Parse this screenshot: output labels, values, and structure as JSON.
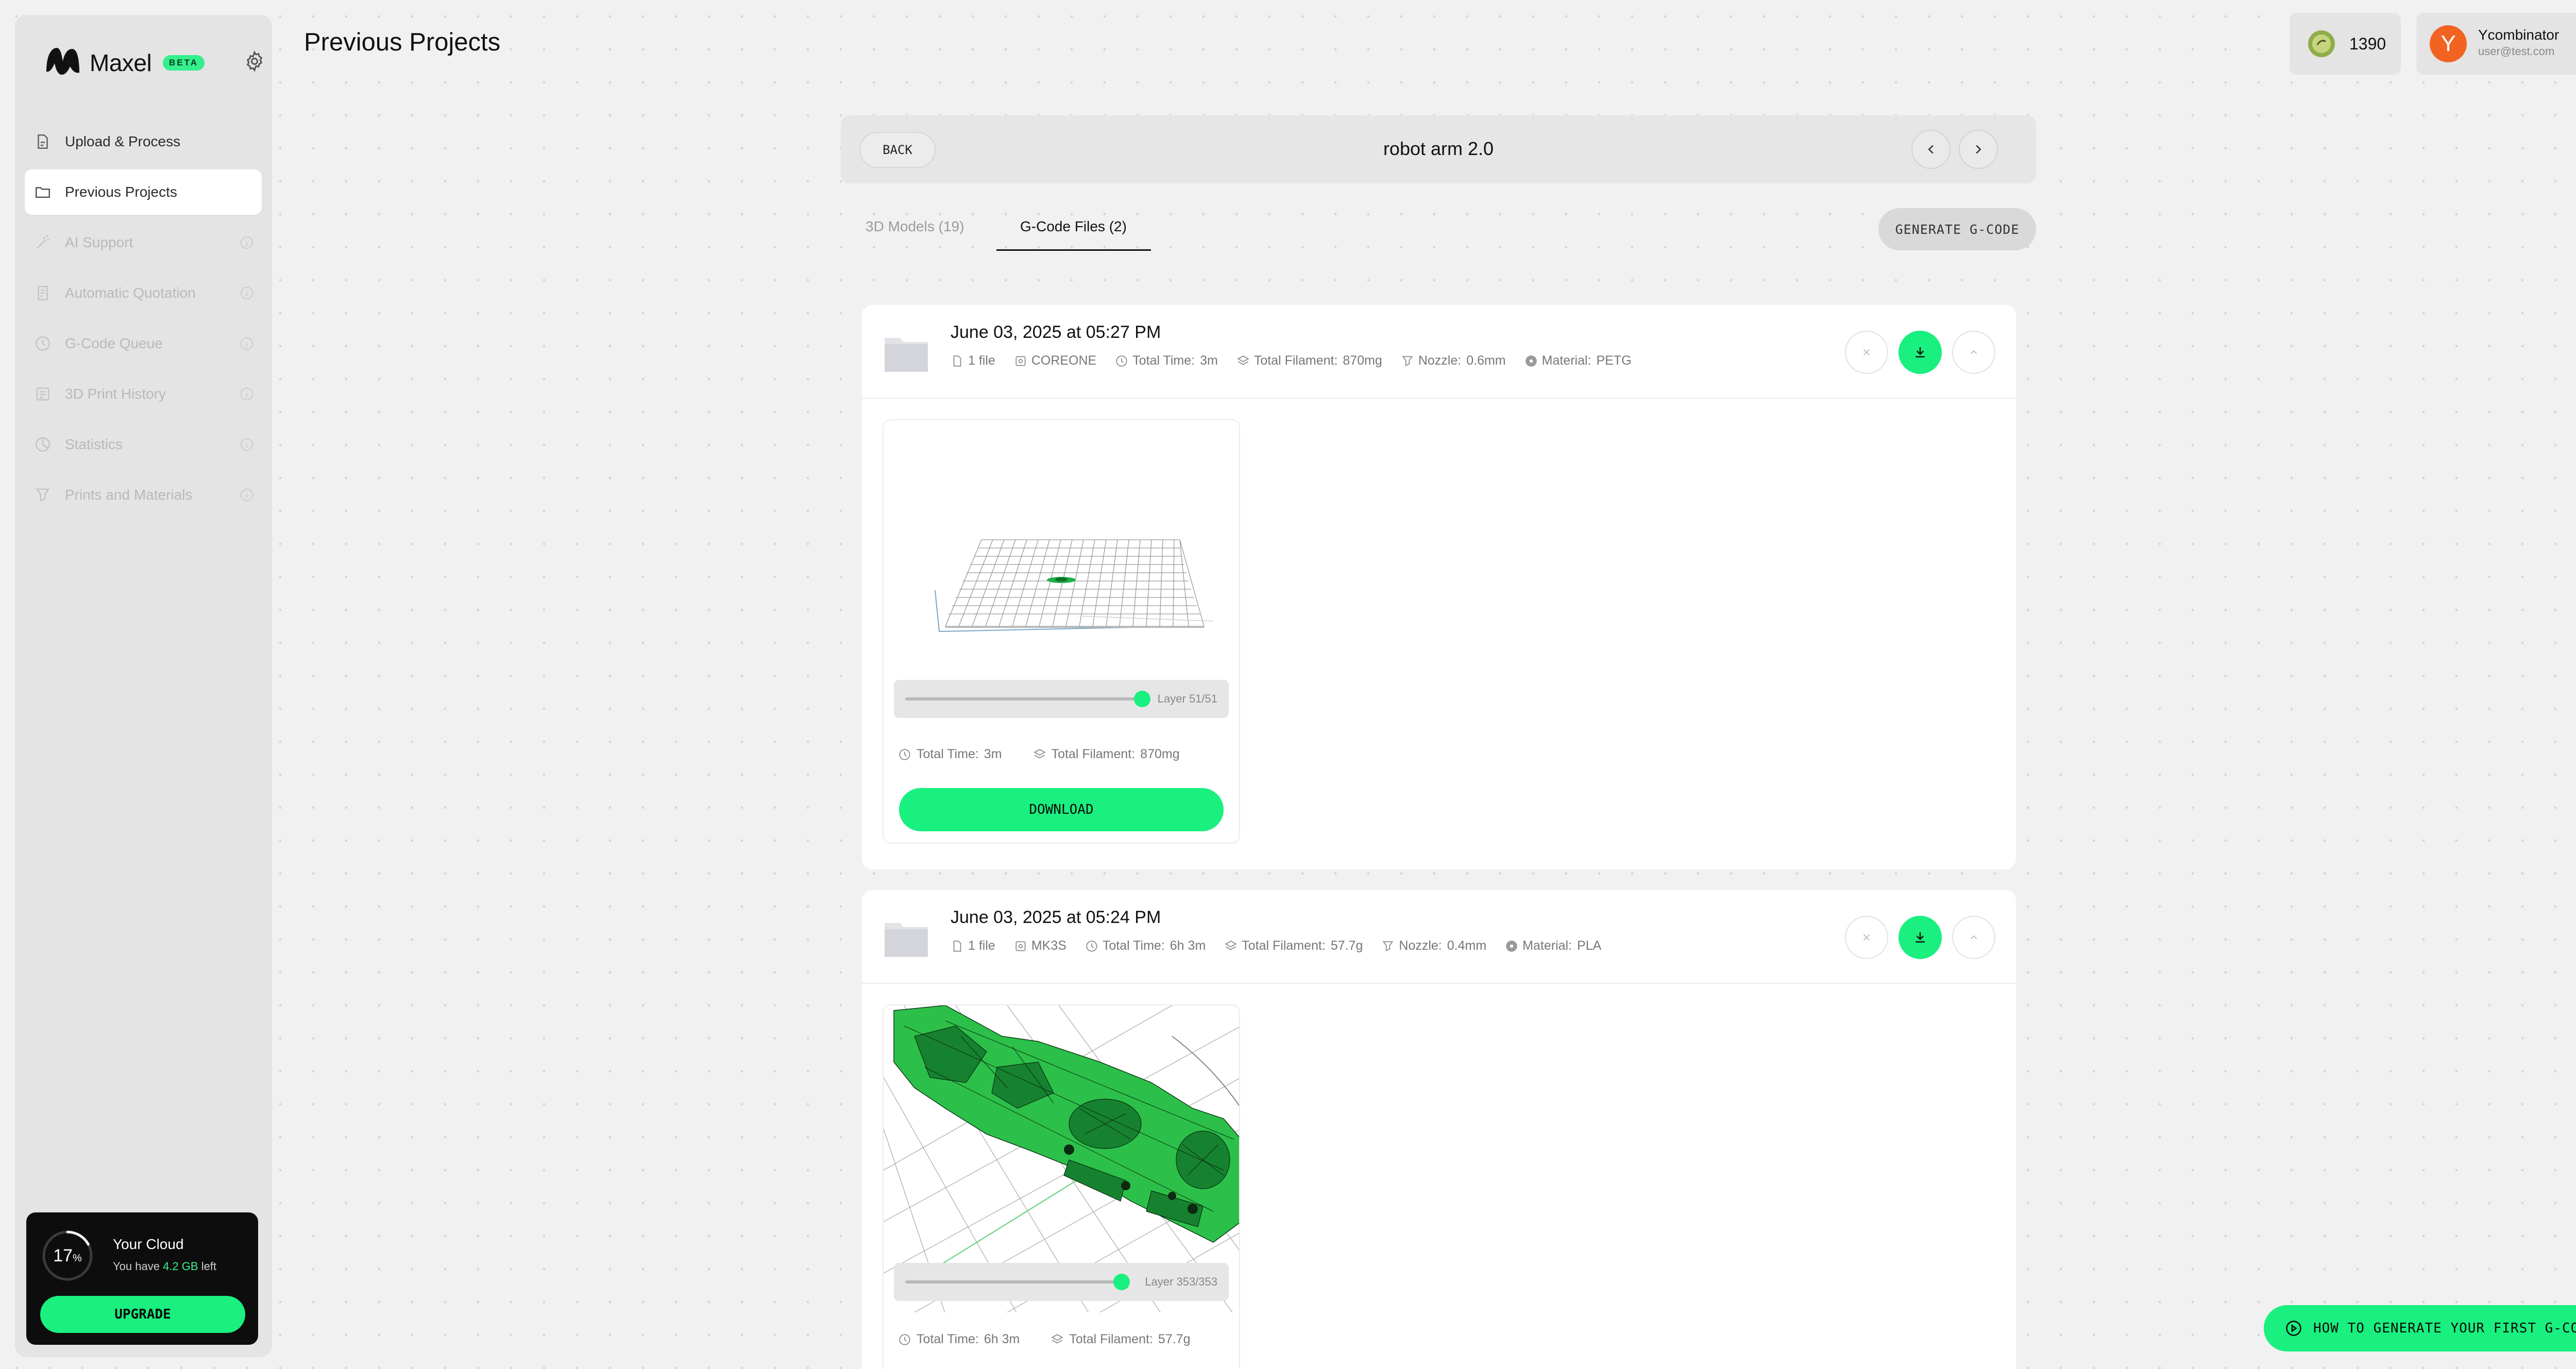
{
  "app": {
    "name": "Maxel",
    "badge": "BETA"
  },
  "sidebar": {
    "items": [
      {
        "label": "Upload & Process",
        "state": "normal"
      },
      {
        "label": "Previous Projects",
        "state": "active"
      },
      {
        "label": "AI Support",
        "state": "disabled"
      },
      {
        "label": "Automatic Quotation",
        "state": "disabled"
      },
      {
        "label": "G-Code Queue",
        "state": "disabled"
      },
      {
        "label": "3D Print History",
        "state": "disabled"
      },
      {
        "label": "Statistics",
        "state": "disabled"
      },
      {
        "label": "Prints and Materials",
        "state": "disabled"
      }
    ],
    "cloud": {
      "percent": "17",
      "percent_sign": "%",
      "title": "Your Cloud",
      "sub_prefix": "You have",
      "amount": "4.2 GB",
      "sub_suffix": "left",
      "upgrade_label": "UPGRADE"
    }
  },
  "header": {
    "page_title": "Previous Projects",
    "credits": "1390",
    "user_name": "Ycombinator",
    "user_email": "user@test.com",
    "avatar_letter": "Y"
  },
  "project": {
    "back_label": "BACK",
    "name": "robot arm 2.0",
    "tabs": [
      {
        "label": "3D Models (19)",
        "active": false
      },
      {
        "label": "G-Code Files (2)",
        "active": true
      }
    ],
    "generate_label": "GENERATE G-CODE"
  },
  "gcode_files": [
    {
      "date": "June 03, 2025 at 05:27 PM",
      "files": "1 file",
      "printer": "COREONE",
      "time_label": "Total Time:",
      "time": "3m",
      "filament_label": "Total Filament:",
      "filament": "870mg",
      "nozzle_label": "Nozzle:",
      "nozzle": "0.6mm",
      "material_label": "Material:",
      "material": "PETG",
      "layer_label": "Layer 51/51",
      "layer_fraction": 1.0,
      "download_label": "DOWNLOAD"
    },
    {
      "date": "June 03, 2025 at 05:24 PM",
      "files": "1 file",
      "printer": "MK3S",
      "time_label": "Total Time:",
      "time": "6h 3m",
      "filament_label": "Total Filament:",
      "filament": "57.7g",
      "nozzle_label": "Nozzle:",
      "nozzle": "0.4mm",
      "material_label": "Material:",
      "material": "PLA",
      "layer_label": "Layer 353/353",
      "layer_fraction": 1.0
    }
  ],
  "help_button": "HOW TO GENERATE YOUR FIRST G-CODE",
  "colors": {
    "accent": "#19f07f",
    "avatar": "#f26322",
    "background": "#f1f1f1"
  }
}
